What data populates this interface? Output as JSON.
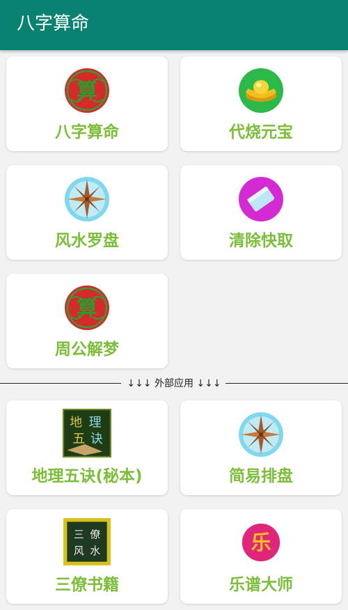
{
  "app": {
    "title": "八字算命"
  },
  "cards": [
    {
      "label": "八字算命",
      "icon": "suan-seal-icon"
    },
    {
      "label": "代烧元宝",
      "icon": "gold-ingot-icon"
    },
    {
      "label": "风水罗盘",
      "icon": "compass-icon"
    },
    {
      "label": "清除快取",
      "icon": "eraser-icon"
    },
    {
      "label": "周公解梦",
      "icon": "suan-seal-icon"
    }
  ],
  "divider": {
    "text": "↓↓↓ 外部应用 ↓↓↓"
  },
  "external_cards": [
    {
      "label": "地理五诀(秘本)",
      "icon": "dili-wujue-book-icon"
    },
    {
      "label": "简易排盘",
      "icon": "compass-icon"
    },
    {
      "label": "三僚书籍",
      "icon": "sanliao-fengshui-board-icon"
    },
    {
      "label": "乐谱大师",
      "icon": "yue-music-icon"
    }
  ],
  "colors": {
    "appbar": "#0a8272",
    "label_green": "#7cbd3a",
    "background": "#f2f2f2"
  }
}
